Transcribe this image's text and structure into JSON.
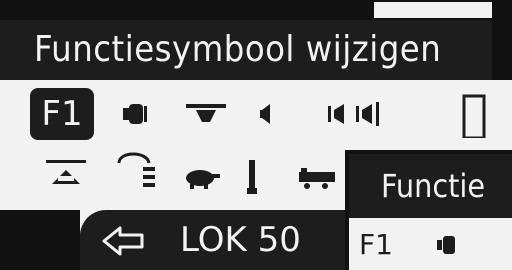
{
  "header": {
    "title": "Functiesymbool wijzigen"
  },
  "symbols": {
    "selected_label": "F1",
    "row1": [
      "light-icon",
      "horn-icon",
      "whistle-icon",
      "sound-icon",
      "sound-volume-icon",
      "door-icon"
    ],
    "row2": [
      "cab-light-icon",
      "lamp-icon",
      "turtle-icon",
      "coupler-icon",
      "train-icon"
    ]
  },
  "footer": {
    "back_icon": "arrow-left-icon",
    "loco_label": "LOK 50"
  },
  "overlay": {
    "title": "Functie",
    "f1_label": "F1"
  }
}
